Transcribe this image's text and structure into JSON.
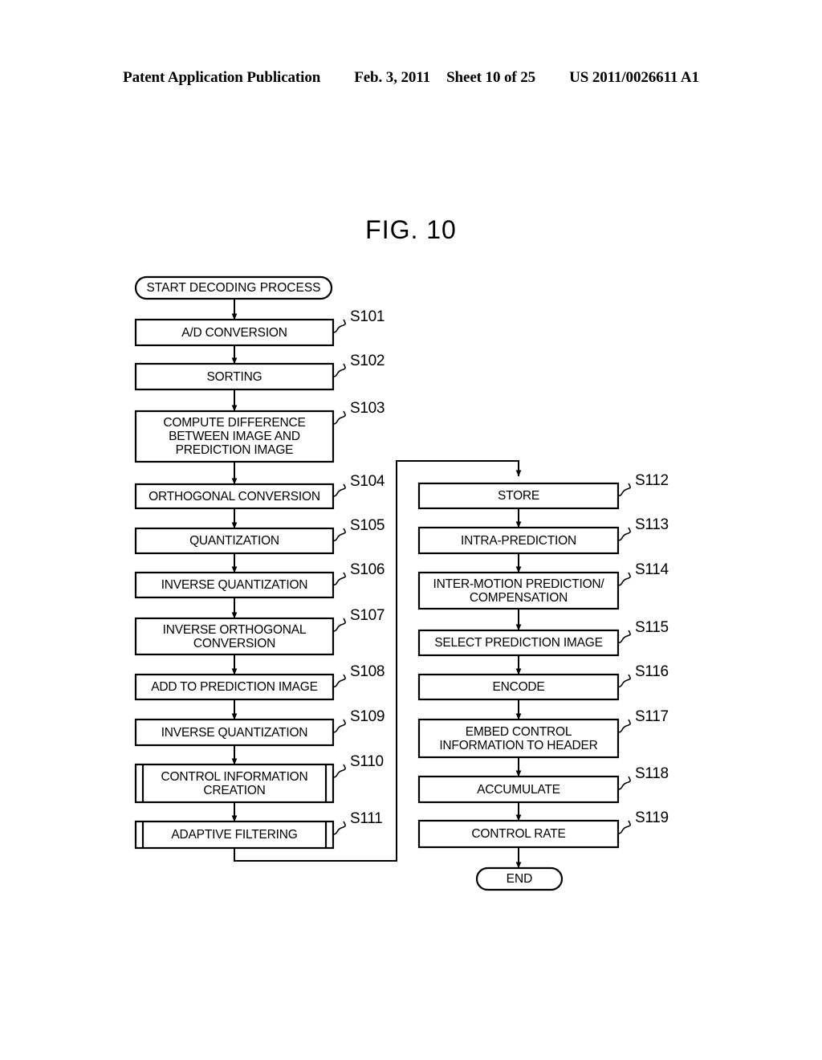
{
  "header": {
    "publication": "Patent Application Publication",
    "date": "Feb. 3, 2011",
    "sheet": "Sheet 10 of 25",
    "number": "US 2011/0026611 A1"
  },
  "figure": {
    "title": "FIG. 10",
    "type": "flowchart",
    "stroke_color": "#000000",
    "fill_color": "#ffffff"
  },
  "flowchart": {
    "start_node": {
      "id": "start",
      "label": "START DECODING PROCESS",
      "shape": "terminal"
    },
    "end_node": {
      "id": "end",
      "label": "END",
      "shape": "terminal"
    },
    "left_column": [
      {
        "id": "S101",
        "tag": "S101",
        "label": "A/D CONVERSION",
        "shape": "process"
      },
      {
        "id": "S102",
        "tag": "S102",
        "label": "SORTING",
        "shape": "process"
      },
      {
        "id": "S103",
        "tag": "S103",
        "label": "COMPUTE DIFFERENCE\nBETWEEN IMAGE AND\nPREDICTION IMAGE",
        "shape": "process"
      },
      {
        "id": "S104",
        "tag": "S104",
        "label": "ORTHOGONAL CONVERSION",
        "shape": "process"
      },
      {
        "id": "S105",
        "tag": "S105",
        "label": "QUANTIZATION",
        "shape": "process"
      },
      {
        "id": "S106",
        "tag": "S106",
        "label": "INVERSE QUANTIZATION",
        "shape": "process"
      },
      {
        "id": "S107",
        "tag": "S107",
        "label": "INVERSE ORTHOGONAL\nCONVERSION",
        "shape": "process"
      },
      {
        "id": "S108",
        "tag": "S108",
        "label": "ADD TO PREDICTION IMAGE",
        "shape": "process"
      },
      {
        "id": "S109",
        "tag": "S109",
        "label": "INVERSE QUANTIZATION",
        "shape": "process"
      },
      {
        "id": "S110",
        "tag": "S110",
        "label": "CONTROL INFORMATION\nCREATION",
        "shape": "subroutine"
      },
      {
        "id": "S111",
        "tag": "S111",
        "label": "ADAPTIVE FILTERING",
        "shape": "subroutine"
      }
    ],
    "right_column": [
      {
        "id": "S112",
        "tag": "S112",
        "label": "STORE",
        "shape": "process"
      },
      {
        "id": "S113",
        "tag": "S113",
        "label": "INTRA-PREDICTION",
        "shape": "process"
      },
      {
        "id": "S114",
        "tag": "S114",
        "label": "INTER-MOTION PREDICTION/\nCOMPENSATION",
        "shape": "process"
      },
      {
        "id": "S115",
        "tag": "S115",
        "label": "SELECT PREDICTION IMAGE",
        "shape": "process"
      },
      {
        "id": "S116",
        "tag": "S116",
        "label": "ENCODE",
        "shape": "process"
      },
      {
        "id": "S117",
        "tag": "S117",
        "label": "EMBED CONTROL\nINFORMATION TO HEADER",
        "shape": "process"
      },
      {
        "id": "S118",
        "tag": "S118",
        "label": "ACCUMULATE",
        "shape": "process"
      },
      {
        "id": "S119",
        "tag": "S119",
        "label": "CONTROL RATE",
        "shape": "process"
      }
    ],
    "connector": {
      "description": "from below ADAPTIVE FILTERING down, right, up and into STORE"
    }
  }
}
